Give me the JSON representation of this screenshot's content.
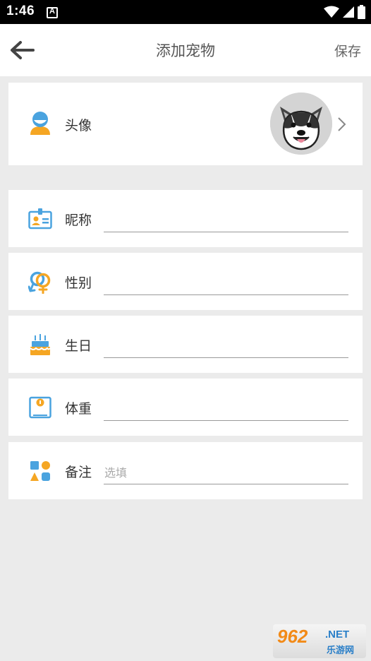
{
  "status_bar": {
    "time": "1:46",
    "icons": [
      "notification-a-icon",
      "wifi-icon",
      "signal-icon",
      "battery-icon"
    ]
  },
  "header": {
    "title": "添加宠物",
    "save_label": "保存",
    "back_icon": "arrow-left-icon"
  },
  "avatar_row": {
    "label": "头像",
    "icon": "person-avatar-icon",
    "image": "husky-dog-avatar",
    "chevron": "chevron-right-icon"
  },
  "fields": {
    "nickname": {
      "label": "昵称",
      "icon": "id-card-icon",
      "value": "",
      "placeholder": ""
    },
    "gender": {
      "label": "性别",
      "icon": "gender-symbols-icon",
      "value": "",
      "placeholder": ""
    },
    "birthday": {
      "label": "生日",
      "icon": "birthday-cake-icon",
      "value": "",
      "placeholder": ""
    },
    "weight": {
      "label": "体重",
      "icon": "scale-icon",
      "value": "",
      "placeholder": ""
    },
    "note": {
      "label": "备注",
      "icon": "shapes-icon",
      "value": "",
      "placeholder": "选填"
    }
  },
  "watermark": {
    "number": "962",
    "domain": ".NET",
    "subtitle": "乐游网"
  },
  "colors": {
    "accent_blue": "#4aa3df",
    "accent_orange": "#f5a623",
    "background": "#ebebeb"
  }
}
